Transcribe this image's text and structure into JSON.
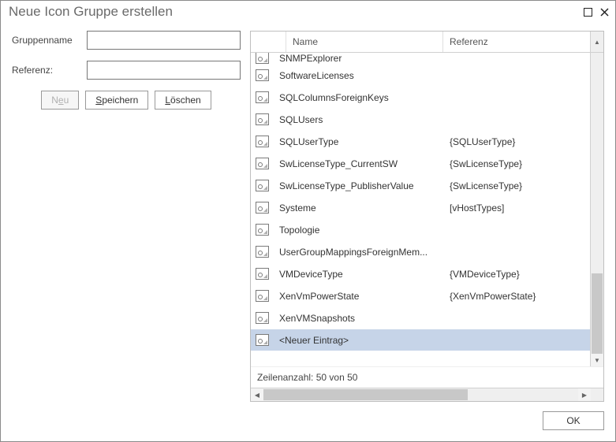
{
  "title": "Neue Icon Gruppe erstellen",
  "form": {
    "groupname_label": "Gruppenname",
    "groupname_value": "",
    "reference_label": "Referenz:",
    "reference_value": "",
    "new_prefix": "N",
    "new_ul": "e",
    "new_suffix": "u",
    "save_prefix": "",
    "save_ul": "S",
    "save_suffix": "peichern",
    "delete_prefix": "",
    "delete_ul": "L",
    "delete_suffix": "öschen"
  },
  "table": {
    "col_name": "Name",
    "col_ref": "Referenz",
    "rows": [
      {
        "name": "SNMPExplorer",
        "ref": "",
        "partial": true
      },
      {
        "name": "SoftwareLicenses",
        "ref": ""
      },
      {
        "name": "SQLColumnsForeignKeys",
        "ref": ""
      },
      {
        "name": "SQLUsers",
        "ref": ""
      },
      {
        "name": "SQLUserType",
        "ref": "{SQLUserType}"
      },
      {
        "name": "SwLicenseType_CurrentSW",
        "ref": "{SwLicenseType}"
      },
      {
        "name": "SwLicenseType_PublisherValue",
        "ref": "{SwLicenseType}"
      },
      {
        "name": "Systeme",
        "ref": "[vHostTypes]"
      },
      {
        "name": "Topologie",
        "ref": ""
      },
      {
        "name": "UserGroupMappingsForeignMem...",
        "ref": ""
      },
      {
        "name": "VMDeviceType",
        "ref": "{VMDeviceType}"
      },
      {
        "name": "XenVmPowerState",
        "ref": "{XenVmPowerState}"
      },
      {
        "name": "XenVMSnapshots",
        "ref": ""
      },
      {
        "name": "  <Neuer Eintrag>",
        "ref": "",
        "selected": true
      }
    ],
    "status": "Zeilenanzahl: 50 von 50"
  },
  "footer": {
    "ok": "OK"
  }
}
